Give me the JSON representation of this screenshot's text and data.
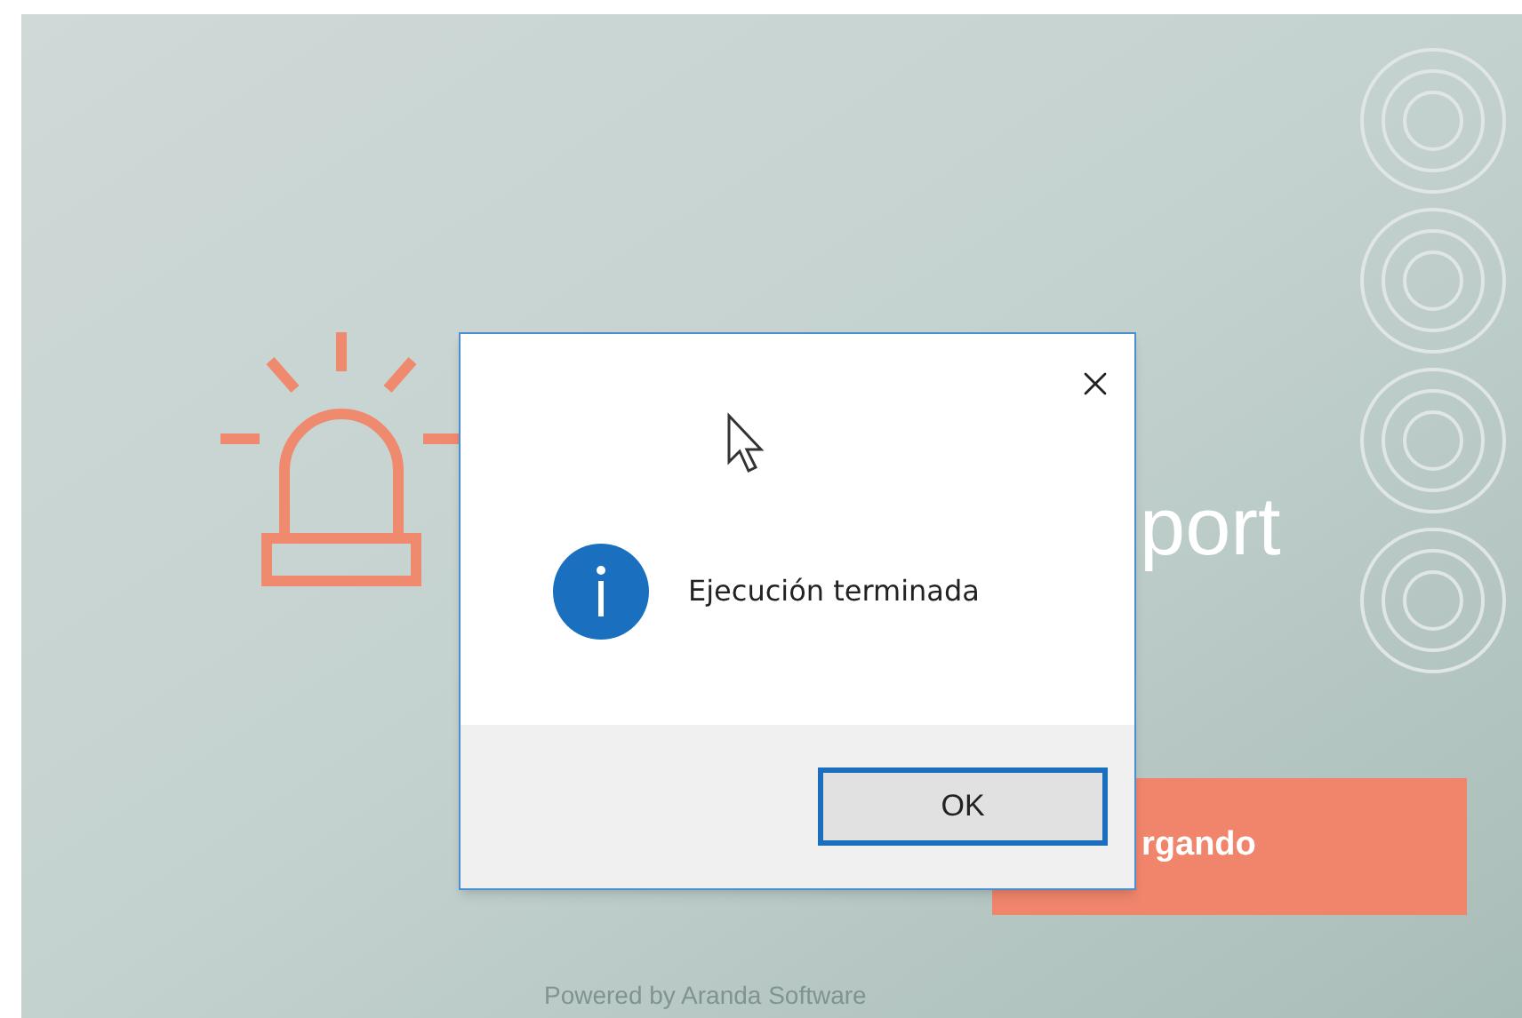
{
  "background_app": {
    "heading_fragment": "port",
    "button_fragment": "rgando",
    "footer": "Powered by Aranda Software"
  },
  "dialog": {
    "message": "Ejecución terminada",
    "buttons": [
      {
        "label": "OK",
        "focused": true
      }
    ]
  }
}
